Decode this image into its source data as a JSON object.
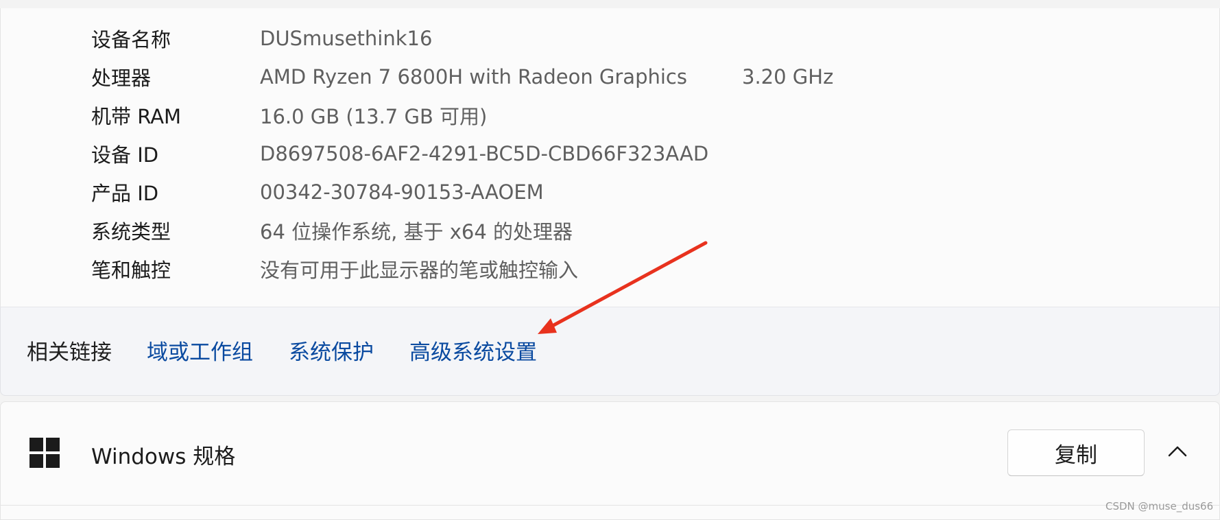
{
  "device_specs": {
    "rows": [
      {
        "label": "设备名称",
        "value": "DUSmusethink16"
      },
      {
        "label": "处理器",
        "value": "AMD Ryzen 7 6800H with Radeon Graphics",
        "extra": "3.20 GHz"
      },
      {
        "label": "机带 RAM",
        "value": "16.0 GB (13.7 GB 可用)"
      },
      {
        "label": "设备 ID",
        "value": "D8697508-6AF2-4291-BC5D-CBD66F323AAD"
      },
      {
        "label": "产品 ID",
        "value": "00342-30784-90153-AAOEM"
      },
      {
        "label": "系统类型",
        "value": "64 位操作系统, 基于 x64 的处理器"
      },
      {
        "label": "笔和触控",
        "value": "没有可用于此显示器的笔或触控输入"
      }
    ]
  },
  "related_links": {
    "label": "相关链接",
    "links": [
      "域或工作组",
      "系统保护",
      "高级系统设置"
    ],
    "link_color": "#0a4aa0"
  },
  "windows_specs": {
    "title": "Windows 规格",
    "copy_label": "复制",
    "logo_icon": "windows-logo-icon",
    "toggle_icon": "chevron-up-icon"
  },
  "annotation": {
    "arrow_color": "#e8321e",
    "points_to": "高级系统设置"
  },
  "watermark": "CSDN @muse_dus66"
}
